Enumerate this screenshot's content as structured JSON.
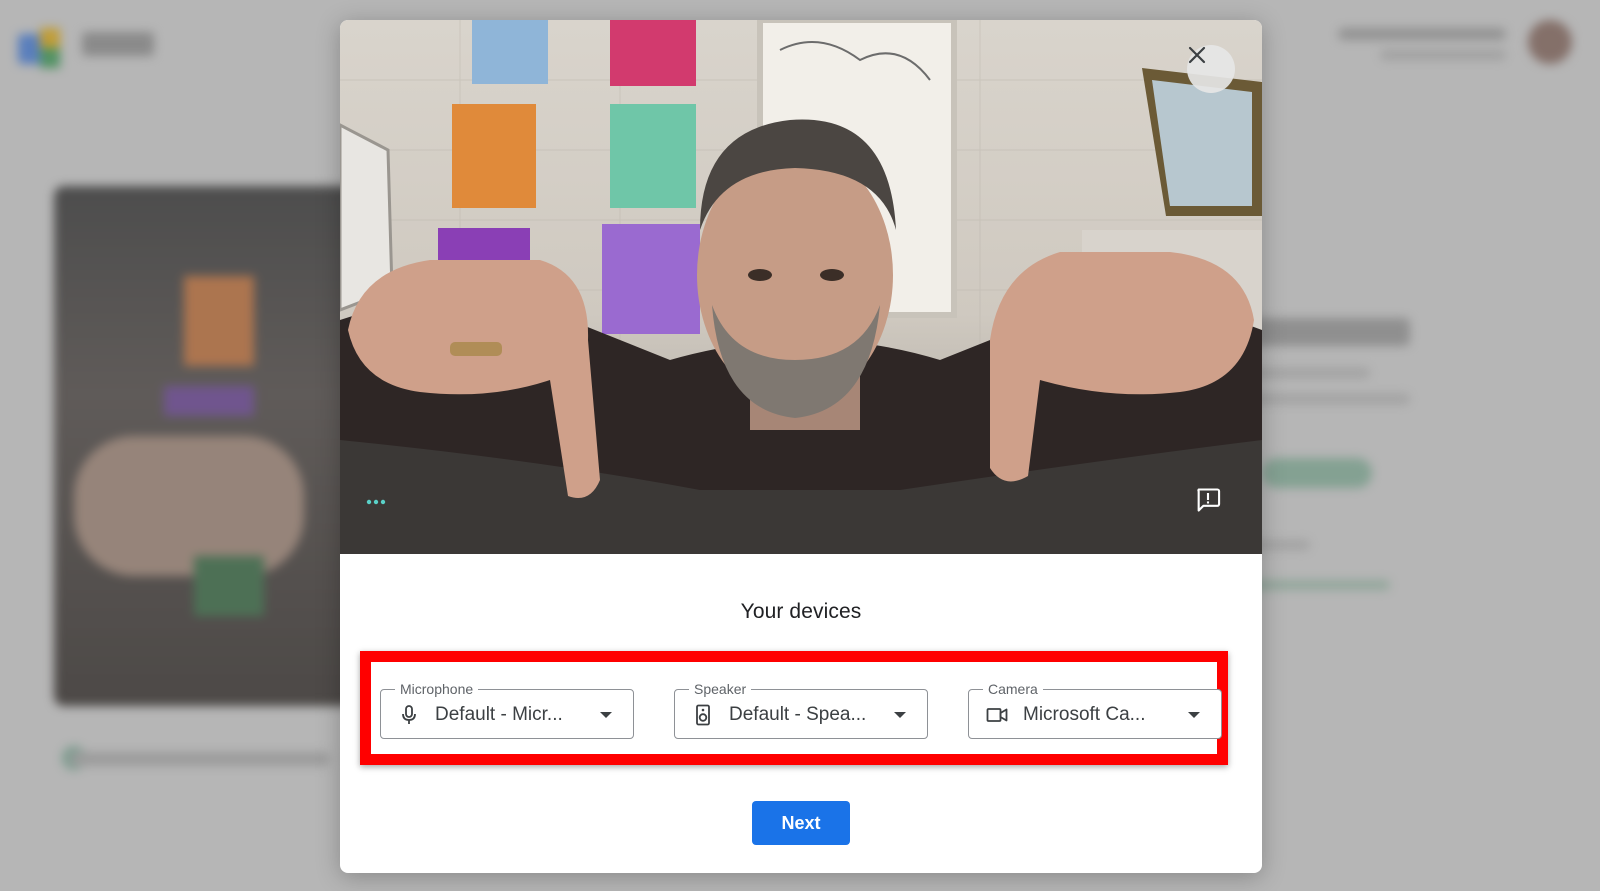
{
  "dialog": {
    "title": "Your devices"
  },
  "devices": {
    "microphone": {
      "label": "Microphone",
      "value": "Default - Micr...",
      "icon": "microphone-icon"
    },
    "speaker": {
      "label": "Speaker",
      "value": "Default - Spea...",
      "icon": "speaker-icon"
    },
    "camera": {
      "label": "Camera",
      "value": "Microsoft Ca...",
      "icon": "video-camera-icon"
    }
  },
  "actions": {
    "next_label": "Next",
    "close_icon": "close-icon",
    "more_icon": "more-options-icon",
    "feedback_icon": "report-feedback-icon"
  },
  "colors": {
    "primary": "#1a73e8",
    "highlight": "#ff0000",
    "more_dots": "#5ad1c8"
  }
}
